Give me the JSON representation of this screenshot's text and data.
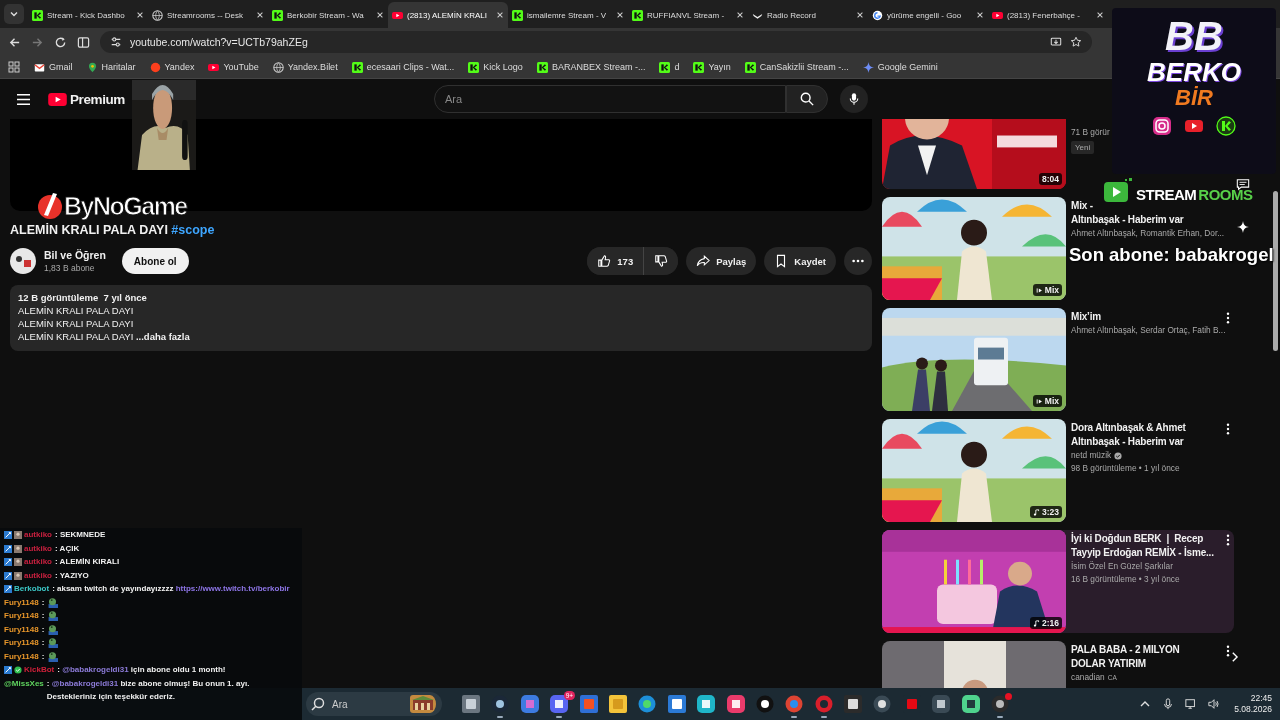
{
  "browser": {
    "tabs": [
      {
        "title": "Stream - Kick Dashbo",
        "selected": false
      },
      {
        "title": "Streamrooms -- Desk",
        "selected": false
      },
      {
        "title": "Berkobir Stream - Wa",
        "selected": false
      },
      {
        "title": "(2813) ALEMİN KRALI",
        "selected": true
      },
      {
        "title": "ismailemre Stream - V",
        "selected": false
      },
      {
        "title": "RUFFIANVL Stream -",
        "selected": false
      },
      {
        "title": "Radio Record",
        "selected": false
      },
      {
        "title": "yürüme engelli - Goo",
        "selected": false
      },
      {
        "title": "(2813) Fenerbahçe -",
        "selected": false
      }
    ],
    "address": "youtube.com/watch?v=UCTb79ahZEg",
    "forward_disabled": true,
    "bookmarks": [
      {
        "label": "Gmail"
      },
      {
        "label": "Haritalar"
      },
      {
        "label": "Yandex"
      },
      {
        "label": "YouTube"
      },
      {
        "label": "Yandex.Bilet"
      },
      {
        "label": "ecesaari Clips - Wat..."
      },
      {
        "label": "Kick Logo"
      },
      {
        "label": "BARANBEX Stream -..."
      },
      {
        "label": "d"
      },
      {
        "label": "Yayın"
      },
      {
        "label": "CanSakizlii Stream -..."
      },
      {
        "label": "Google Gemini"
      }
    ]
  },
  "youtube": {
    "logo": "Premium",
    "search": {
      "placeholder": "Ara"
    },
    "video": {
      "title": "ALEMİN KRALI PALA DAYI",
      "hashtag": "#scope",
      "channel": "Bil ve Öğren",
      "subscribers": "1,83 B abone",
      "subscribe": "Abone ol",
      "likes": "173",
      "share": "Paylaş",
      "save": "Kaydet",
      "description": {
        "stats": "12 B görüntüleme  7 yıl önce",
        "lines": [
          "ALEMİN KRALI PALA DAYI",
          "ALEMİN KRALI PALA DAYI",
          "ALEMİN KRALI PALA DAYI"
        ],
        "more": "...daha fazla"
      }
    },
    "sidebar": [
      {
        "meta": "71 B görür",
        "badge": "Yeni",
        "overlay": {
          "kind": "time",
          "text": "8:04"
        },
        "verified": false,
        "menu": false,
        "hovered": false
      },
      {
        "title": [
          "Mix -",
          "Altınbaşak - Haberim var"
        ],
        "channel": "Ahmet Altınbaşak, Romantik Erhan, Dor...",
        "overlay": {
          "kind": "mix",
          "text": "Mix"
        },
        "verified": false,
        "menu": false,
        "hovered": false
      },
      {
        "title": [
          "Mix’im"
        ],
        "channel": "Ahmet Altınbaşak, Serdar Ortaç, Fatih B...",
        "overlay": {
          "kind": "mix",
          "text": "Mix"
        },
        "verified": false,
        "menu": true,
        "hovered": false
      },
      {
        "title": [
          "Dora Altınbaşak & Ahmet",
          "Altınbaşak - Haberim var"
        ],
        "channel": "netd müzik",
        "meta": "98 B görüntüleme • 1 yıl önce",
        "overlay": {
          "kind": "music",
          "text": "3:23"
        },
        "verified": true,
        "menu": true,
        "hovered": false
      },
      {
        "title": [
          "İyi ki Doğdun BERK  |  Recep",
          "Tayyip Erdoğan REMİX - İsme..."
        ],
        "channel": "İsim Özel En Güzel Şarkılar",
        "meta": "16 B görüntüleme • 3 yıl önce",
        "overlay": {
          "kind": "music",
          "text": "2:16"
        },
        "verified": false,
        "menu": true,
        "hovered": true
      },
      {
        "title": [
          "PALA BABA - 2 MILYON",
          "DOLAR YATIRIM"
        ],
        "channel": "canadian",
        "channel_tag": "CA",
        "verified": false,
        "menu": true,
        "hovered": false
      }
    ]
  },
  "overlay": {
    "streamer_logo": {
      "initials": "BB",
      "name": "BERKO",
      "suffix": "BİR"
    },
    "sponsor": "ByNoGame",
    "streamrooms": [
      "STREAM",
      "ROOMS"
    ],
    "last_subscriber": "Son abone: babakrogel"
  },
  "chat": [
    {
      "user": "autkiko",
      "color": "#c8203f",
      "segments": [
        {
          "kind": "text",
          "text": ": SEKMNEDE"
        }
      ]
    },
    {
      "user": "autkiko",
      "color": "#c8203f",
      "segments": [
        {
          "kind": "text",
          "text": ": AÇIK"
        }
      ]
    },
    {
      "user": "autkiko",
      "color": "#c8203f",
      "segments": [
        {
          "kind": "text",
          "text": ": ALEMİN KIRALI"
        }
      ]
    },
    {
      "user": "autkiko",
      "color": "#c8203f",
      "segments": [
        {
          "kind": "text",
          "text": ": YAZIYO"
        }
      ]
    },
    {
      "user": "Berkobot",
      "color": "#3cc8c8",
      "segments": [
        {
          "kind": "text",
          "text": ": aksam twitch de yayındayızzzz"
        },
        {
          "kind": "link",
          "text": "https://www.twitch.tv/berkobir"
        }
      ]
    },
    {
      "user": "Fury1148",
      "color": "#e8962a",
      "segments": [
        {
          "kind": "text",
          "text": ":"
        },
        {
          "kind": "emote"
        }
      ]
    },
    {
      "user": "Fury1148",
      "color": "#e8962a",
      "segments": [
        {
          "kind": "text",
          "text": ":"
        },
        {
          "kind": "emote"
        }
      ]
    },
    {
      "user": "Fury1148",
      "color": "#e8962a",
      "segments": [
        {
          "kind": "text",
          "text": ":"
        },
        {
          "kind": "emote"
        }
      ]
    },
    {
      "user": "Fury1148",
      "color": "#e8962a",
      "segments": [
        {
          "kind": "text",
          "text": ":"
        },
        {
          "kind": "emote"
        }
      ]
    },
    {
      "user": "Fury1148",
      "color": "#e8962a",
      "segments": [
        {
          "kind": "text",
          "text": ":"
        },
        {
          "kind": "emote"
        }
      ]
    },
    {
      "user": "KickBot",
      "color": "#d0203a",
      "segments": [
        {
          "kind": "text",
          "text": ":"
        },
        {
          "kind": "mention",
          "text": "@babakrogeldi31"
        },
        {
          "kind": "text",
          "text": "için abone oldu 1 month!"
        }
      ]
    },
    {
      "user": "@MissXes",
      "color": "#5fd35f",
      "segments": [
        {
          "kind": "text",
          "text": ":"
        },
        {
          "kind": "mention",
          "text": "@babakrogeldi31"
        },
        {
          "kind": "text",
          "text": "bize abone olmuş! Bu onun 1. ayı. Destekleriniz için teşekkür ederiz."
        }
      ]
    }
  ],
  "taskbar": {
    "search": {
      "placeholder": "Ara"
    },
    "apps": [
      {
        "running": false,
        "dot": false
      },
      {
        "running": true,
        "dot": false
      },
      {
        "running": false,
        "dot": false
      },
      {
        "running": true,
        "dot": false,
        "badge": "9+"
      },
      {
        "running": false,
        "dot": false
      },
      {
        "running": false,
        "dot": false
      },
      {
        "running": false,
        "dot": false
      },
      {
        "running": false,
        "dot": false
      },
      {
        "running": false,
        "dot": false
      },
      {
        "running": false,
        "dot": false
      },
      {
        "running": false,
        "dot": false
      },
      {
        "running": true,
        "dot": false
      },
      {
        "running": true,
        "dot": false
      },
      {
        "running": false,
        "dot": false
      },
      {
        "running": false,
        "dot": false
      },
      {
        "running": false,
        "dot": false
      },
      {
        "running": false,
        "dot": false
      },
      {
        "running": false,
        "dot": false
      },
      {
        "running": true,
        "dot": true
      }
    ],
    "time": "22:45",
    "date": "5.08.2026"
  }
}
